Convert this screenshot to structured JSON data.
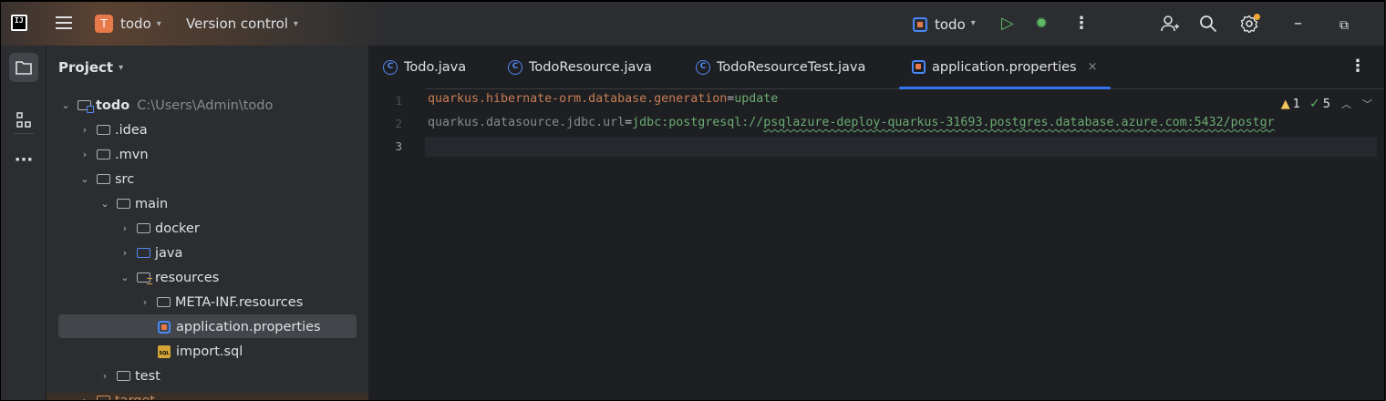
{
  "titlebar": {
    "logo_text": "IJ",
    "project_badge": "T",
    "project_name": "todo",
    "vcs_label": "Version control",
    "run_config": "todo",
    "icons": [
      "main-menu-icon",
      "run-icon",
      "debug-icon",
      "more-icon",
      "code-with-me-icon",
      "search-icon",
      "settings-icon",
      "minimize-icon",
      "restore-icon"
    ]
  },
  "toolstripe": {
    "items": [
      "project-tool-icon",
      "structure-icon",
      "more-tools-icon"
    ]
  },
  "project_panel": {
    "title": "Project",
    "tree": [
      {
        "label": "todo",
        "path": "C:\\Users\\Admin\\todo",
        "expanded": true
      },
      {
        "label": ".idea",
        "expanded": false
      },
      {
        "label": ".mvn",
        "expanded": false
      },
      {
        "label": "src",
        "expanded": true
      },
      {
        "label": "main",
        "expanded": true
      },
      {
        "label": "docker",
        "expanded": false
      },
      {
        "label": "java",
        "expanded": false
      },
      {
        "label": "resources",
        "expanded": true
      },
      {
        "label": "META-INF.resources",
        "expanded": false
      },
      {
        "label": "application.properties",
        "selected": true
      },
      {
        "label": "import.sql"
      },
      {
        "label": "test",
        "expanded": false
      },
      {
        "label": "target",
        "expanded": false
      }
    ]
  },
  "editor": {
    "tabs": [
      {
        "label": "Todo.java",
        "active": false
      },
      {
        "label": "TodoResource.java",
        "active": false
      },
      {
        "label": "TodoResourceTest.java",
        "active": false
      },
      {
        "label": "application.properties",
        "active": true
      }
    ],
    "close_glyph": "×",
    "line_numbers": [
      "1",
      "2",
      "3"
    ],
    "lines": [
      {
        "key": "quarkus.hibernate-orm.database.generation",
        "eq": "=",
        "value": "update"
      },
      {
        "key": "quarkus.datasource.jdbc.url",
        "eq": "=",
        "value_prefix": "jdbc:postgresql://",
        "value_url": "psqlazure-deploy-quarkus-31693.postgres.database.azure.com:5432/postgr"
      },
      {
        "key": "",
        "eq": "",
        "value": ""
      }
    ],
    "inspections": {
      "warnings": "1",
      "ok": "5"
    }
  }
}
